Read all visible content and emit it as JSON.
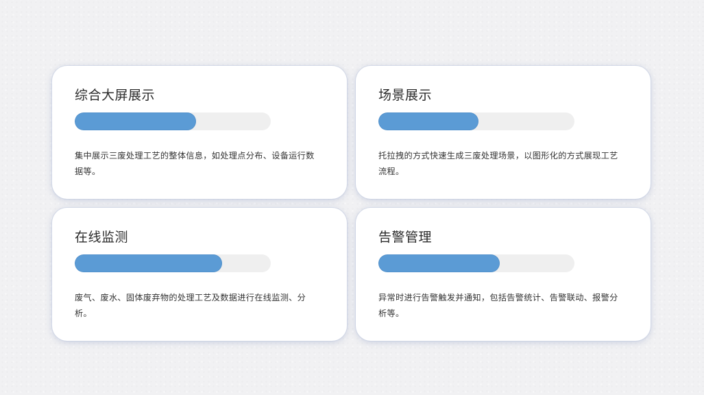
{
  "cards": [
    {
      "title": "综合大屏展示",
      "progress": 0.62,
      "description": "集中展示三废处理工艺的整体信息，如处理点分布、设备运行数据等。"
    },
    {
      "title": "场景展示",
      "progress": 0.51,
      "description": "托拉拽的方式快速生成三废处理场景，以图形化的方式展现工艺流程。"
    },
    {
      "title": "在线监测",
      "progress": 0.75,
      "description": "废气、废水、固体废弃物的处理工艺及数据进行在线监测、分析。"
    },
    {
      "title": "告警管理",
      "progress": 0.62,
      "description": "异常时进行告警触发并通知，包括告警统计、告警联动、报警分析等。"
    }
  ],
  "colors": {
    "progress_fill": "#5b9bd5",
    "progress_track": "#efefef",
    "card_bg": "#ffffff",
    "page_bg": "#f1f1f3"
  }
}
